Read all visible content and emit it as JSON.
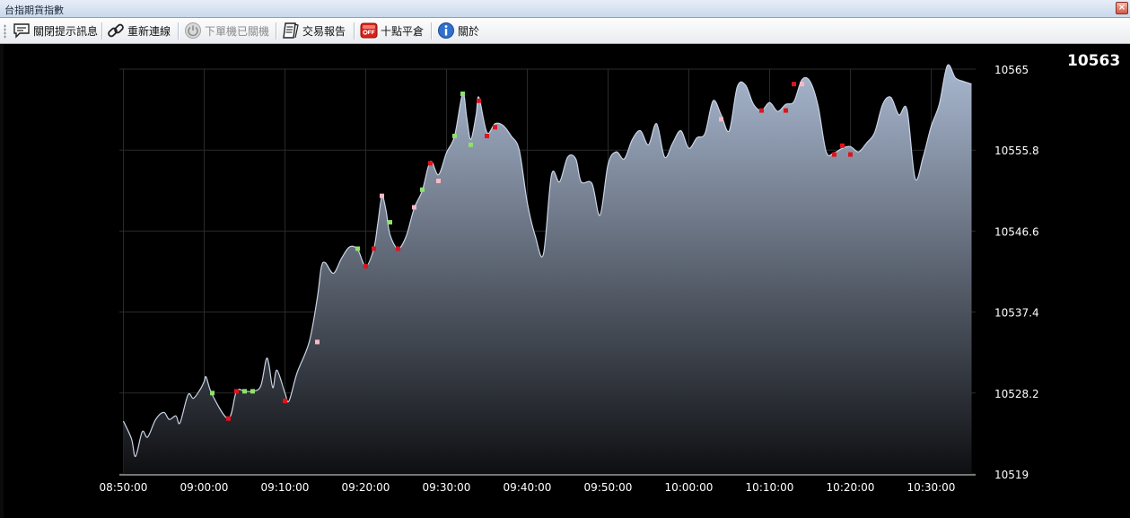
{
  "window": {
    "title": "台指期貨指數",
    "close_glyph": "×"
  },
  "toolbar": {
    "items": [
      {
        "label": "關閉提示訊息",
        "icon": "chat-bubble-icon",
        "enabled": true
      },
      {
        "label": "重新連線",
        "icon": "link-icon",
        "enabled": true
      },
      {
        "label": "下單機已關機",
        "icon": "power-icon",
        "enabled": false
      },
      {
        "label": "交易報告",
        "icon": "report-icon",
        "enabled": true
      },
      {
        "label": "十點平倉",
        "icon": "off-icon",
        "enabled": true
      },
      {
        "label": "關於",
        "icon": "info-icon",
        "enabled": true
      }
    ]
  },
  "last_price": "10563",
  "colors": {
    "background": "#000000",
    "area_top": "#a9b8d0",
    "area_bottom": "#0e0f12",
    "grid": "#2a2a2a",
    "marker_red": "#e0141c",
    "marker_pink": "#f7b9c4",
    "marker_green": "#8fe06c"
  },
  "chart_data": {
    "type": "area",
    "title": "",
    "xlabel": "",
    "ylabel": "",
    "x_ticks": [
      "08:50:00",
      "09:00:00",
      "09:10:00",
      "09:20:00",
      "09:30:00",
      "09:40:00",
      "09:50:00",
      "10:00:00",
      "10:10:00",
      "10:20:00",
      "10:30:00"
    ],
    "y_ticks": [
      "10565",
      "10555.8",
      "10546.6",
      "10537.4",
      "10528.2",
      "10519"
    ],
    "ylim": [
      10519,
      10565
    ],
    "xlim": [
      "08:49:30",
      "10:35:30"
    ],
    "grid": true,
    "series": [
      {
        "values": [
          [
            "08:50:00",
            10525.0
          ],
          [
            "08:51:00",
            10523.0
          ],
          [
            "08:51:30",
            10521.0
          ],
          [
            "08:52:20",
            10523.8
          ],
          [
            "08:53:00",
            10523.2
          ],
          [
            "08:54:00",
            10525.2
          ],
          [
            "08:55:00",
            10526.0
          ],
          [
            "08:55:40",
            10525.2
          ],
          [
            "08:56:30",
            10525.6
          ],
          [
            "08:57:00",
            10524.8
          ],
          [
            "08:58:00",
            10528.0
          ],
          [
            "08:58:40",
            10527.6
          ],
          [
            "08:59:30",
            10528.6
          ],
          [
            "09:00:00",
            10529.5
          ],
          [
            "09:00:15",
            10530.0
          ],
          [
            "09:01:00",
            10528.0
          ],
          [
            "09:03:00",
            10525.3
          ],
          [
            "09:04:00",
            10528.4
          ],
          [
            "09:05:00",
            10528.4
          ],
          [
            "09:06:00",
            10528.4
          ],
          [
            "09:07:00",
            10529.0
          ],
          [
            "09:07:40",
            10532.0
          ],
          [
            "09:08:00",
            10531.5
          ],
          [
            "09:08:30",
            10528.8
          ],
          [
            "09:09:00",
            10530.8
          ],
          [
            "09:10:00",
            10528.2
          ],
          [
            "09:10:30",
            10527.3
          ],
          [
            "09:11:30",
            10530.5
          ],
          [
            "09:13:00",
            10534.0
          ],
          [
            "09:14:00",
            10539.0
          ],
          [
            "09:14:30",
            10542.5
          ],
          [
            "09:15:00",
            10543.0
          ],
          [
            "09:16:00",
            10541.8
          ],
          [
            "09:17:00",
            10543.5
          ],
          [
            "09:18:00",
            10544.8
          ],
          [
            "09:19:00",
            10544.5
          ],
          [
            "09:20:00",
            10542.6
          ],
          [
            "09:21:00",
            10544.6
          ],
          [
            "09:21:30",
            10547.5
          ],
          [
            "09:22:00",
            10550.5
          ],
          [
            "09:22:30",
            10549.0
          ],
          [
            "09:23:00",
            10546.2
          ],
          [
            "09:24:00",
            10544.6
          ],
          [
            "09:25:00",
            10546.0
          ],
          [
            "09:26:00",
            10549.2
          ],
          [
            "09:27:00",
            10551.2
          ],
          [
            "09:28:00",
            10554.5
          ],
          [
            "09:29:00",
            10553.0
          ],
          [
            "09:30:00",
            10555.5
          ],
          [
            "09:31:00",
            10557.4
          ],
          [
            "09:32:00",
            10562.2
          ],
          [
            "09:32:30",
            10559.5
          ],
          [
            "09:33:00",
            10557.0
          ],
          [
            "09:33:40",
            10559.8
          ],
          [
            "09:34:00",
            10561.8
          ],
          [
            "09:35:00",
            10557.8
          ],
          [
            "09:36:00",
            10558.8
          ],
          [
            "09:37:00",
            10558.6
          ],
          [
            "09:38:00",
            10557.4
          ],
          [
            "09:39:00",
            10555.8
          ],
          [
            "09:40:00",
            10549.8
          ],
          [
            "09:41:00",
            10546.0
          ],
          [
            "09:42:00",
            10544.0
          ],
          [
            "09:43:00",
            10553.0
          ],
          [
            "09:44:00",
            10552.2
          ],
          [
            "09:45:00",
            10555.0
          ],
          [
            "09:46:00",
            10554.8
          ],
          [
            "09:46:40",
            10552.2
          ],
          [
            "09:48:00",
            10552.0
          ],
          [
            "09:49:00",
            10548.4
          ],
          [
            "09:50:00",
            10554.2
          ],
          [
            "09:51:00",
            10555.6
          ],
          [
            "09:52:00",
            10554.8
          ],
          [
            "09:53:00",
            10557.0
          ],
          [
            "09:54:00",
            10558.0
          ],
          [
            "09:55:00",
            10556.4
          ],
          [
            "09:56:00",
            10558.8
          ],
          [
            "09:57:00",
            10555.0
          ],
          [
            "09:58:00",
            10556.6
          ],
          [
            "09:59:00",
            10558.0
          ],
          [
            "10:00:00",
            10556.0
          ],
          [
            "10:01:00",
            10557.2
          ],
          [
            "10:02:00",
            10557.7
          ],
          [
            "10:03:00",
            10561.4
          ],
          [
            "10:04:00",
            10559.8
          ],
          [
            "10:05:00",
            10558.0
          ],
          [
            "10:06:00",
            10563.0
          ],
          [
            "10:07:00",
            10563.2
          ],
          [
            "10:08:00",
            10561.0
          ],
          [
            "10:09:00",
            10560.3
          ],
          [
            "10:10:00",
            10561.2
          ],
          [
            "10:11:00",
            10560.2
          ],
          [
            "10:12:00",
            10561.0
          ],
          [
            "10:13:00",
            10561.3
          ],
          [
            "10:14:00",
            10563.8
          ],
          [
            "10:15:00",
            10563.6
          ],
          [
            "10:16:00",
            10560.8
          ],
          [
            "10:17:00",
            10555.6
          ],
          [
            "10:18:00",
            10555.5
          ],
          [
            "10:19:00",
            10556.0
          ],
          [
            "10:20:00",
            10556.2
          ],
          [
            "10:21:00",
            10555.6
          ],
          [
            "10:22:00",
            10556.6
          ],
          [
            "10:23:00",
            10557.8
          ],
          [
            "10:24:00",
            10561.0
          ],
          [
            "10:25:00",
            10561.8
          ],
          [
            "10:26:00",
            10559.8
          ],
          [
            "10:27:00",
            10560.4
          ],
          [
            "10:28:00",
            10552.6
          ],
          [
            "10:29:00",
            10555.0
          ],
          [
            "10:30:00",
            10558.5
          ],
          [
            "10:31:00",
            10561.0
          ],
          [
            "10:32:00",
            10565.4
          ],
          [
            "10:33:00",
            10564.0
          ],
          [
            "10:34:00",
            10563.6
          ],
          [
            "10:35:00",
            10563.3
          ]
        ]
      }
    ],
    "markers": [
      {
        "x": "09:01:00",
        "y": 10528.2,
        "color": "green"
      },
      {
        "x": "09:03:00",
        "y": 10525.3,
        "color": "red"
      },
      {
        "x": "09:04:00",
        "y": 10528.4,
        "color": "red"
      },
      {
        "x": "09:05:00",
        "y": 10528.4,
        "color": "green"
      },
      {
        "x": "09:06:00",
        "y": 10528.4,
        "color": "green"
      },
      {
        "x": "09:10:00",
        "y": 10527.3,
        "color": "red"
      },
      {
        "x": "09:14:00",
        "y": 10534.0,
        "color": "pink"
      },
      {
        "x": "09:19:00",
        "y": 10544.6,
        "color": "green"
      },
      {
        "x": "09:20:00",
        "y": 10542.6,
        "color": "red"
      },
      {
        "x": "09:21:00",
        "y": 10544.6,
        "color": "red"
      },
      {
        "x": "09:22:00",
        "y": 10550.6,
        "color": "pink"
      },
      {
        "x": "09:23:00",
        "y": 10547.6,
        "color": "green"
      },
      {
        "x": "09:24:00",
        "y": 10544.6,
        "color": "red"
      },
      {
        "x": "09:26:00",
        "y": 10549.3,
        "color": "pink"
      },
      {
        "x": "09:27:00",
        "y": 10551.3,
        "color": "green"
      },
      {
        "x": "09:28:00",
        "y": 10554.3,
        "color": "red"
      },
      {
        "x": "09:29:00",
        "y": 10552.3,
        "color": "pink"
      },
      {
        "x": "09:31:00",
        "y": 10557.4,
        "color": "green"
      },
      {
        "x": "09:32:00",
        "y": 10562.2,
        "color": "green"
      },
      {
        "x": "09:33:00",
        "y": 10556.4,
        "color": "green"
      },
      {
        "x": "09:34:00",
        "y": 10561.4,
        "color": "red"
      },
      {
        "x": "09:35:00",
        "y": 10557.4,
        "color": "red"
      },
      {
        "x": "09:36:00",
        "y": 10558.4,
        "color": "red"
      },
      {
        "x": "10:04:00",
        "y": 10559.3,
        "color": "pink"
      },
      {
        "x": "10:09:00",
        "y": 10560.3,
        "color": "red"
      },
      {
        "x": "10:12:00",
        "y": 10560.3,
        "color": "red"
      },
      {
        "x": "10:13:00",
        "y": 10563.3,
        "color": "red"
      },
      {
        "x": "10:14:00",
        "y": 10563.3,
        "color": "pink"
      },
      {
        "x": "10:18:00",
        "y": 10555.3,
        "color": "red"
      },
      {
        "x": "10:19:00",
        "y": 10556.3,
        "color": "red"
      },
      {
        "x": "10:20:00",
        "y": 10555.3,
        "color": "red"
      }
    ]
  }
}
